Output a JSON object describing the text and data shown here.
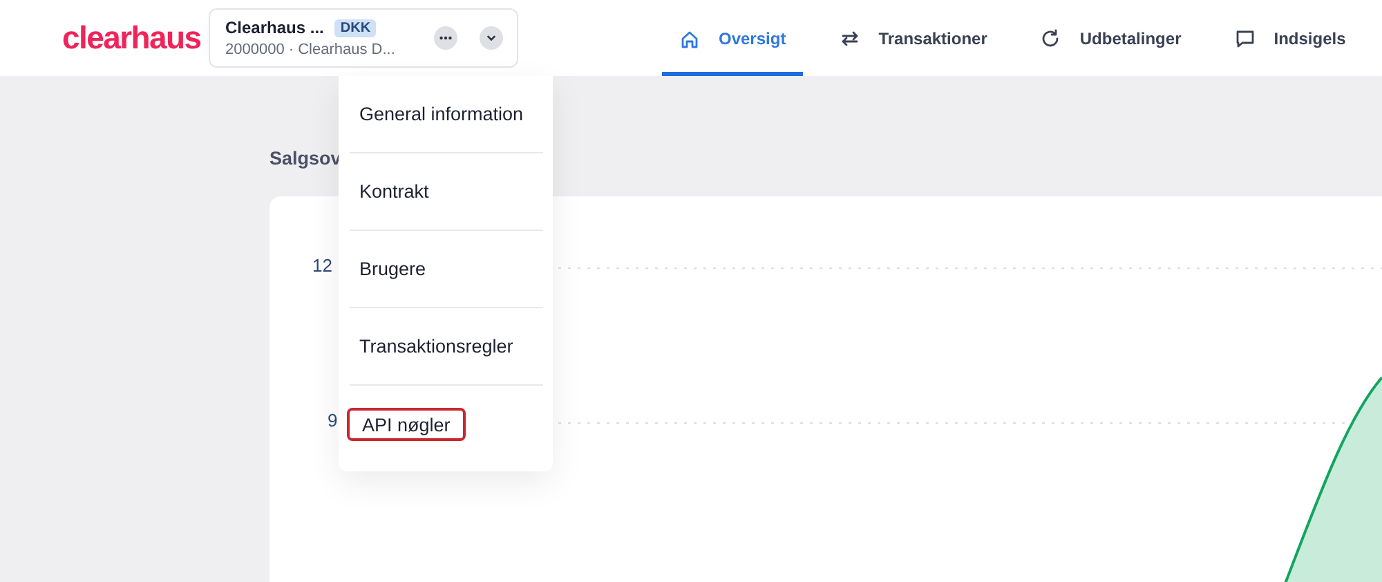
{
  "header": {
    "logo": "clearhaus",
    "account": {
      "name": "Clearhaus ...",
      "currency": "DKK",
      "detail": "2000000 · Clearhaus D..."
    },
    "nav": [
      {
        "label": "Oversigt",
        "selected": true
      },
      {
        "label": "Transaktioner",
        "selected": false
      },
      {
        "label": "Udbetalinger",
        "selected": false
      },
      {
        "label": "Indsigels",
        "selected": false
      }
    ]
  },
  "page": {
    "heading": "Salgsov",
    "chart": {
      "y_labels": [
        "12",
        "9"
      ]
    }
  },
  "menu": {
    "items": [
      {
        "label": "General information",
        "highlighted": false
      },
      {
        "label": "Kontrakt",
        "highlighted": false
      },
      {
        "label": "Brugere",
        "highlighted": false
      },
      {
        "label": "Transaktionsregler",
        "highlighted": false
      },
      {
        "label": "API nøgler",
        "highlighted": true
      }
    ]
  }
}
